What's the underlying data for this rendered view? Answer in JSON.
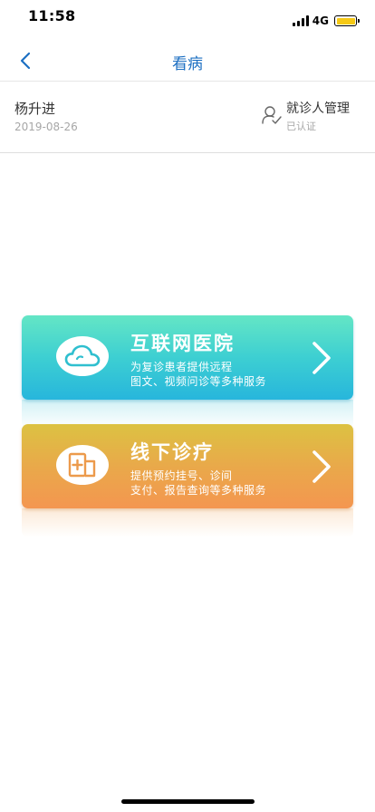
{
  "status_bar": {
    "time": "11:58",
    "network": "4G",
    "battery_color": "#f6c915"
  },
  "nav": {
    "back_icon": "chevron-left-icon",
    "title": "看病"
  },
  "patient": {
    "name": "杨升进",
    "date": "2019-08-26",
    "manage_label": "就诊人管理",
    "manage_status": "已认证",
    "manage_icon": "user-verified-icon"
  },
  "cards": [
    {
      "title": "互联网医院",
      "desc_line1": "为复诊患者提供远程",
      "desc_line2": "图文、视频问诊等多种服务",
      "icon": "cloud-icon",
      "icon_color": "#2fbfcf",
      "arrow_icon": "chevron-right-icon"
    },
    {
      "title": "线下诊疗",
      "desc_line1": "提供预约挂号、诊间",
      "desc_line2": "支付、报告查询等多种服务",
      "icon": "hospital-plus-icon",
      "icon_color": "#ec9a4b",
      "arrow_icon": "chevron-right-icon"
    }
  ],
  "colors": {
    "accent_blue": "#1c6fc2",
    "online_gradient_top": "#64e6c5",
    "online_gradient_bottom": "#27b6dc",
    "offline_gradient_top": "#dcc242",
    "offline_gradient_bottom": "#f49650"
  }
}
